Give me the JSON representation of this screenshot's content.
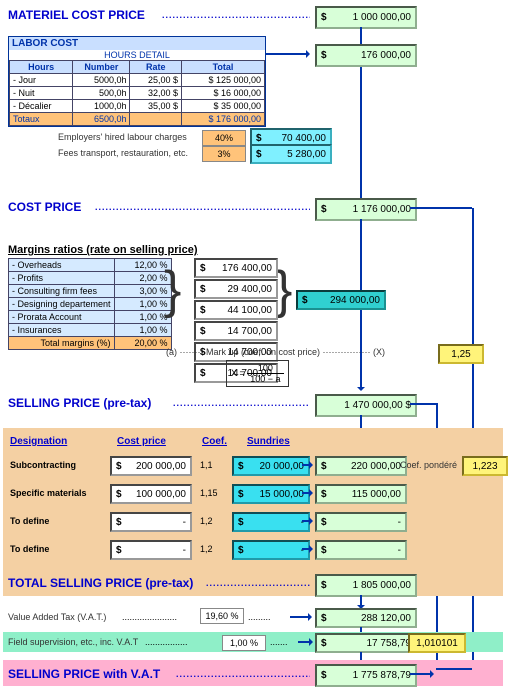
{
  "materiel": {
    "label": "MATERIEL COST PRICE",
    "value": "1 000 000,00"
  },
  "labor": {
    "title": "LABOR COST",
    "total": "176 000,00",
    "subtitle": "HOURS DETAIL",
    "cols": [
      "Hours",
      "Number",
      "Rate",
      "Total"
    ],
    "rows": [
      {
        "name": "- Jour",
        "num": "5000,0h",
        "rate": "25,00 $",
        "tot": "125 000,00"
      },
      {
        "name": "- Nuit",
        "num": "500,0h",
        "rate": "32,00 $",
        "tot": "16 000,00"
      },
      {
        "name": "- Décalier",
        "num": "1000,0h",
        "rate": "35,00 $",
        "tot": "35 000,00"
      }
    ],
    "sumrow": {
      "name": "Totaux",
      "num": "6500,0h",
      "rate": "",
      "tot": "176 000,00"
    },
    "employers": {
      "label": "Employers' hired labour charges",
      "pct": "40%",
      "val": "70 400,00"
    },
    "fees": {
      "label": "Fees transport, restauration, etc.",
      "pct": "3%",
      "val": "5 280,00"
    }
  },
  "cost_price": {
    "label": "COST PRICE",
    "value": "1 176 000,00"
  },
  "margins": {
    "title": "Margins ratios (rate on selling price)",
    "rows": [
      {
        "name": "- Overheads",
        "pct": "12,00 %",
        "val": "176 400,00"
      },
      {
        "name": "- Profits",
        "pct": "2,00 %",
        "val": "29 400,00"
      },
      {
        "name": "- Consulting firm fees",
        "pct": "3,00 %",
        "val": "44 100,00"
      },
      {
        "name": "- Designing departement",
        "pct": "1,00 %",
        "val": "14 700,00"
      },
      {
        "name": "- Prorata Account ",
        "pct": "1,00 %",
        "val": "14 700,00"
      },
      {
        "name": "- Insurances",
        "pct": "1,00 %",
        "val": "14 700,00"
      }
    ],
    "total_label": "Total margins (%)",
    "total_pct": "20,00 %",
    "markup_label": "(a) ········ Mark up (coef. on cost price) ················ (X)",
    "markup_val": "1,25",
    "margin_total": "294 000,00",
    "formula_top": "100",
    "formula_bot": "100 − a",
    "formula_x": "X ="
  },
  "selling_pre": {
    "label": "SELLING PRICE (pre-tax)",
    "value": "1 470 000,00 $"
  },
  "extras": {
    "head_design": "Designation",
    "head_cost": "Cost price",
    "head_coef": "Coef.",
    "head_sund": "Sundries",
    "rows": [
      {
        "name": "Subcontracting",
        "cost": "200 000,00",
        "coef": "1,1",
        "sund": "20 000,00",
        "tot": "220 000,00"
      },
      {
        "name": "Specific materials",
        "cost": "100 000,00",
        "coef": "1,15",
        "sund": "15 000,00",
        "tot": "115 000,00"
      },
      {
        "name": "To define",
        "cost": "-",
        "coef": "1,2",
        "sund": "-",
        "tot": "-"
      },
      {
        "name": "To define",
        "cost": "-",
        "coef": "1,2",
        "sund": "-",
        "tot": "-"
      }
    ],
    "coef_pond_label": "Coef. pondéré",
    "coef_pond_val": "1,223"
  },
  "total_sell": {
    "label": "TOTAL SELLING PRICE (pre-tax)",
    "value": "1 805 000,00"
  },
  "vat": {
    "label": "Value Added Tax (V.A.T.)",
    "pct": "19,60 %",
    "value": "288 120,00"
  },
  "field": {
    "label": "Field supervision, etc., inc. V.A.T",
    "pct": "1,00 %",
    "value": "17 758,79",
    "coef": "1,010101"
  },
  "final": {
    "label": "SELLING PRICE with V.A.T",
    "value": "1 775 878,79"
  },
  "currency": "$"
}
